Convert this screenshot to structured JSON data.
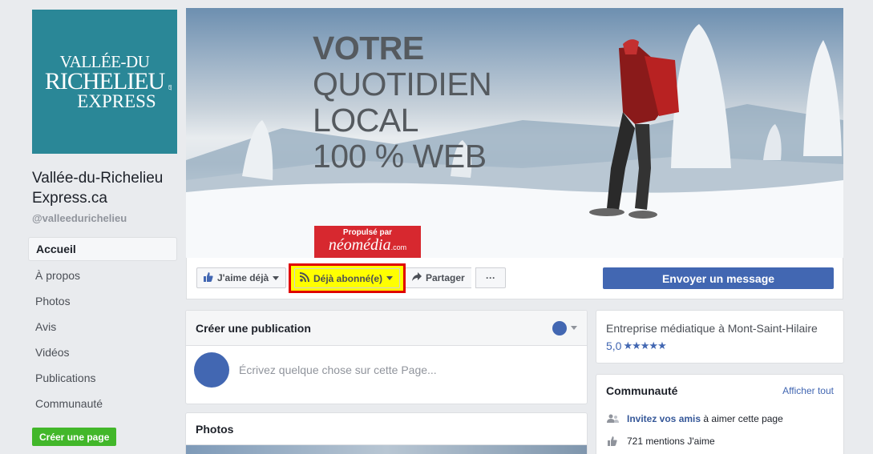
{
  "logo": {
    "line1": "VALLÉE-DU",
    "line2": "RICHELIEU",
    "line2_suffix": ".ca",
    "line3": "EXPRESS",
    "bg_color": "#2a8797"
  },
  "page": {
    "name": "Vallée-du-Richelieu Express.ca",
    "handle": "@valleedurichelieu"
  },
  "nav": {
    "items": [
      {
        "label": "Accueil",
        "active": true
      },
      {
        "label": "À propos"
      },
      {
        "label": "Photos"
      },
      {
        "label": "Avis"
      },
      {
        "label": "Vidéos"
      },
      {
        "label": "Publications"
      },
      {
        "label": "Communauté"
      }
    ],
    "create_page": "Créer une page"
  },
  "cover": {
    "line1": "VOTRE",
    "line2": "QUOTIDIEN",
    "line3": "LOCAL",
    "line4": "100 % WEB",
    "badge_top": "Propulsé par",
    "badge_brand": "néomédia",
    "badge_suffix": ".com"
  },
  "actions": {
    "like": "J'aime déjà",
    "follow": "Déjà abonné(e)",
    "share": "Partager",
    "more": "···",
    "message": "Envoyer un message",
    "highlight_color": "#ffff00",
    "highlight_border": "#e00000"
  },
  "create_post": {
    "title": "Créer une publication",
    "placeholder": "Écrivez quelque chose sur cette Page..."
  },
  "photos": {
    "title": "Photos"
  },
  "about": {
    "category": "Entreprise médiatique à Mont-Saint-Hilaire",
    "rating": "5,0",
    "stars": 5
  },
  "community": {
    "title": "Communauté",
    "see_all": "Afficher tout",
    "invite_link": "Invitez vos amis",
    "invite_rest": " à aimer cette page",
    "likes": "721 mentions J'aime"
  },
  "colors": {
    "facebook_blue": "#4267b2",
    "green": "#42b72a",
    "bg": "#e9ebee"
  }
}
